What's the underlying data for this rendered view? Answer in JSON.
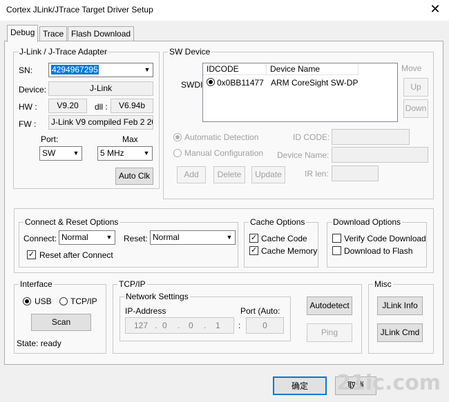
{
  "window": {
    "title": "Cortex JLink/JTrace Target Driver Setup",
    "close_glyph": "✕"
  },
  "tabs": [
    "Debug",
    "Trace",
    "Flash Download"
  ],
  "adapter": {
    "legend": "J-Link / J-Trace Adapter",
    "sn_label": "SN:",
    "sn_value": "4294967295",
    "device_label": "Device:",
    "device_value": "J-Link",
    "hw_label": "HW :",
    "hw_value": "V9.20",
    "dll_label": "dll :",
    "dll_value": "V6.94b",
    "fw_label": "FW :",
    "fw_value": "J-Link V9 compiled Feb  2 20",
    "port_label": "Port:",
    "port_value": "SW",
    "max_label": "Max",
    "max_value": "5 MHz",
    "auto_clk": "Auto Clk"
  },
  "sw_device": {
    "legend": "SW Device",
    "swdi_label": "SWDI",
    "columns": [
      "IDCODE",
      "Device Name"
    ],
    "rows": [
      {
        "idcode": "0x0BB11477",
        "name": "ARM CoreSight SW-DP"
      }
    ],
    "move_label": "Move",
    "up": "Up",
    "down": "Down",
    "auto_detection": "Automatic Detection",
    "manual_config": "Manual Configuration",
    "id_code_label": "ID CODE:",
    "device_name_label": "Device Name:",
    "ir_len_label": "IR len:",
    "add": "Add",
    "delete": "Delete",
    "update": "Update"
  },
  "connect_reset": {
    "legend": "Connect & Reset Options",
    "connect_label": "Connect:",
    "connect_value": "Normal",
    "reset_label": "Reset:",
    "reset_value": "Normal",
    "reset_after_connect": "Reset after Connect"
  },
  "cache": {
    "legend": "Cache Options",
    "cache_code": "Cache Code",
    "cache_memory": "Cache Memory"
  },
  "download": {
    "legend": "Download Options",
    "verify": "Verify Code Download",
    "flash": "Download to Flash"
  },
  "interface": {
    "legend": "Interface",
    "usb": "USB",
    "tcpip": "TCP/IP",
    "scan": "Scan",
    "state": "State: ready"
  },
  "tcpip": {
    "legend": "TCP/IP",
    "net_legend": "Network Settings",
    "ip_label": "IP-Address",
    "ip": [
      "127",
      "0",
      "0",
      "1"
    ],
    "port_label": "Port (Auto:",
    "port_value": "0",
    "autodetect": "Autodetect",
    "ping": "Ping"
  },
  "misc": {
    "legend": "Misc",
    "jlink_info": "JLink Info",
    "jlink_cmd": "JLink Cmd"
  },
  "footer": {
    "ok": "确定",
    "cancel": "取消",
    "watermark": "21ic.com"
  }
}
